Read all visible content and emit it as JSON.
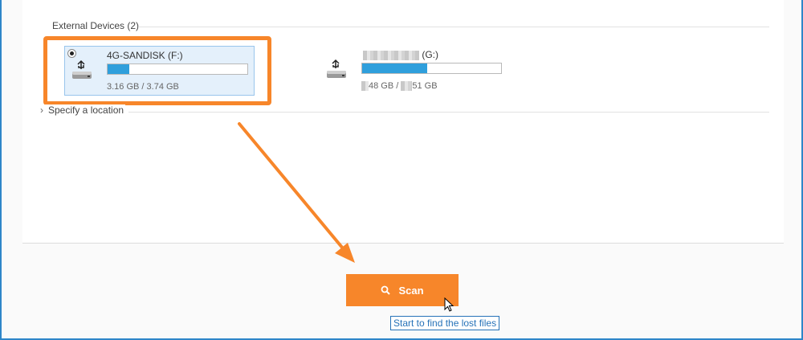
{
  "section": {
    "label": "External Devices (2)"
  },
  "devices": [
    {
      "name": "4G-SANDISK (F:)",
      "size_text": "3.16 GB / 3.74 GB",
      "used_fraction": 0.155,
      "selected": true
    },
    {
      "name_suffix": "(G:)",
      "size_used_suffix": "48 GB /",
      "size_total_suffix": "51 GB",
      "used_fraction": 0.47,
      "selected": false
    }
  ],
  "specify": {
    "label": "Specify a location"
  },
  "scan": {
    "label": "Scan",
    "icon": "search-icon",
    "tooltip": "Start to find the lost files"
  },
  "colors": {
    "accent": "#f7862a",
    "bar_fill": "#2f9fdc",
    "tooltip_blue": "#2672b8"
  }
}
